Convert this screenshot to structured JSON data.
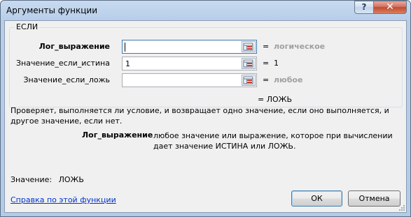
{
  "window": {
    "title": "Аргументы функции",
    "help_glyph": "?",
    "close_glyph": "✕"
  },
  "function": {
    "name": "ЕСЛИ",
    "args": [
      {
        "label": "Лог_выражение",
        "value": "",
        "hint": "логическое",
        "bold": true
      },
      {
        "label": "Значение_если_истина",
        "value": "1",
        "hint": "1",
        "bold": false
      },
      {
        "label": "Значение_если_ложь",
        "value": "",
        "hint": "любое",
        "bold": false
      }
    ],
    "equals": "=",
    "result_line": "=  ЛОЖЬ",
    "description": "Проверяет, выполняется ли условие, и возвращает одно значение, если оно выполняется, и другое значение, если нет.",
    "arg_desc_name": "Лог_выражение",
    "arg_desc_text": "любое значение или выражение, которое при вычислении дает значение ИСТИНА или ЛОЖЬ."
  },
  "footer": {
    "value_label": "Значение:",
    "value": "ЛОЖЬ",
    "help_link": "Справка по этой функции",
    "ok_label": "ОК",
    "cancel_label": "Отмена"
  },
  "colors": {
    "titlebar": "#b7cde8",
    "client_bg": "#f0f0f0",
    "link": "#0033cc",
    "hint_grey": "#a0a0a0",
    "close_red": "#c14b30"
  },
  "icons": {
    "collapse_button": "range-select-icon"
  }
}
